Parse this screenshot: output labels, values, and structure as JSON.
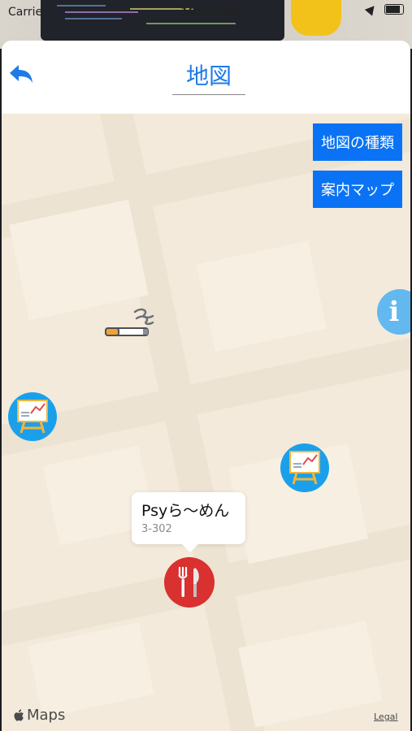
{
  "status_bar": {
    "carrier": "Carrie",
    "time": "10:11 AM"
  },
  "nav": {
    "title": "地図"
  },
  "map_controls": {
    "map_type_label": "地図の種類",
    "guide_map_label": "案内マップ",
    "info_label": "i"
  },
  "callout": {
    "title": "Psyら～めん",
    "subtitle": "3-302"
  },
  "map_footer": {
    "maps_label": "Maps",
    "legal_label": "Legal"
  },
  "colors": {
    "accent": "#1e7be8",
    "button_blue": "#0a73f5",
    "pin_blue": "#1aa0ea",
    "info_blue": "#62b8ef",
    "food_red": "#d93030",
    "map_bg": "#f3eadb"
  },
  "icons": [
    "back-arrow-icon",
    "location-arrow-icon",
    "battery-icon",
    "info-icon",
    "smoking-icon",
    "whiteboard-icon",
    "fork-knife-icon",
    "apple-logo-icon"
  ]
}
